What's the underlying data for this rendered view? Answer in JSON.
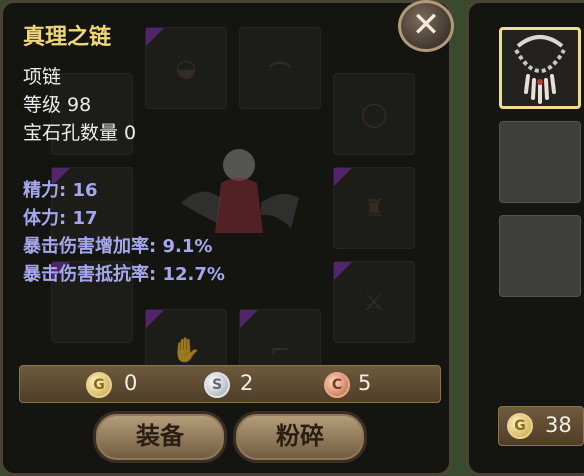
{
  "item": {
    "name": "真理之链",
    "type": "项链",
    "level": "等级 98",
    "gem_slots": "宝石孔数量 0"
  },
  "stats": [
    "精力: 16",
    "体力: 17",
    "暴击伤害增加率: 9.1%",
    "暴击伤害抵抗率: 12.7%"
  ],
  "cost": {
    "gold": "0",
    "silver": "2",
    "copper": "5"
  },
  "buttons": {
    "equip": "装备",
    "smash": "粉碎",
    "close": "✕"
  },
  "side": {
    "coins": "38"
  },
  "icons": {
    "gold_coin": "G",
    "silver_coin": "S",
    "copper_coin": "C"
  },
  "colors": {
    "title": "#f0d878",
    "stat": "#a6a8ee",
    "selected_border": "#f0dc90"
  }
}
